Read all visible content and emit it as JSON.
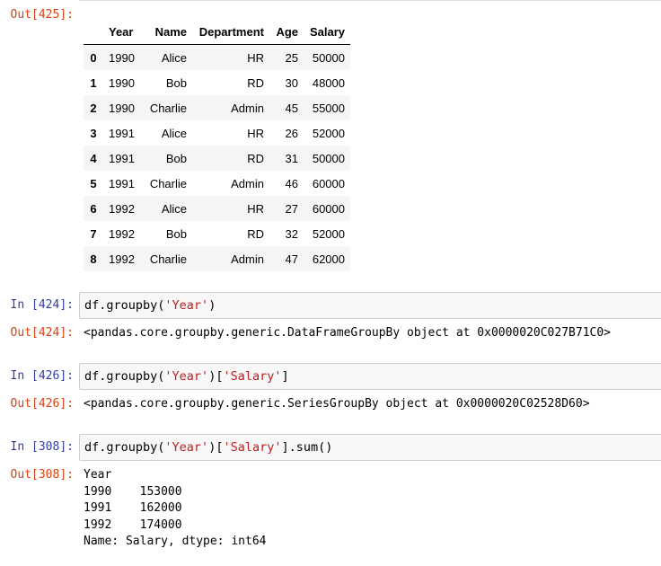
{
  "out425": {
    "prompt": "Out[425]:",
    "columns": [
      "",
      "Year",
      "Name",
      "Department",
      "Age",
      "Salary"
    ],
    "rows": [
      [
        "0",
        "1990",
        "Alice",
        "HR",
        "25",
        "50000"
      ],
      [
        "1",
        "1990",
        "Bob",
        "RD",
        "30",
        "48000"
      ],
      [
        "2",
        "1990",
        "Charlie",
        "Admin",
        "45",
        "55000"
      ],
      [
        "3",
        "1991",
        "Alice",
        "HR",
        "26",
        "52000"
      ],
      [
        "4",
        "1991",
        "Bob",
        "RD",
        "31",
        "50000"
      ],
      [
        "5",
        "1991",
        "Charlie",
        "Admin",
        "46",
        "60000"
      ],
      [
        "6",
        "1992",
        "Alice",
        "HR",
        "27",
        "60000"
      ],
      [
        "7",
        "1992",
        "Bob",
        "RD",
        "32",
        "52000"
      ],
      [
        "8",
        "1992",
        "Charlie",
        "Admin",
        "47",
        "62000"
      ]
    ]
  },
  "cell424": {
    "in_prompt": "In [424]:",
    "code_prefix": "df.groupby(",
    "code_arg": "'Year'",
    "code_suffix": ")",
    "out_prompt": "Out[424]:",
    "output": "<pandas.core.groupby.generic.DataFrameGroupBy object at 0x0000020C027B71C0>"
  },
  "cell426": {
    "in_prompt": "In [426]:",
    "code_prefix": "df.groupby(",
    "code_arg": "'Year'",
    "code_mid": ")[",
    "code_arg2": "'Salary'",
    "code_suffix": "]",
    "out_prompt": "Out[426]:",
    "output": "<pandas.core.groupby.generic.SeriesGroupBy object at 0x0000020C02528D60>"
  },
  "cell308": {
    "in_prompt": "In [308]:",
    "code_prefix": "df.groupby(",
    "code_arg": "'Year'",
    "code_mid": ")[",
    "code_arg2": "'Salary'",
    "code_suffix": "].sum()",
    "out_prompt": "Out[308]:",
    "output_lines": [
      "Year",
      "1990    153000",
      "1991    162000",
      "1992    174000",
      "Name: Salary, dtype: int64"
    ]
  },
  "colors": {
    "in_prompt": "#303f9f",
    "out_prompt": "#d84315",
    "string": "#ba2121",
    "input_bg": "#f7f7f7"
  }
}
